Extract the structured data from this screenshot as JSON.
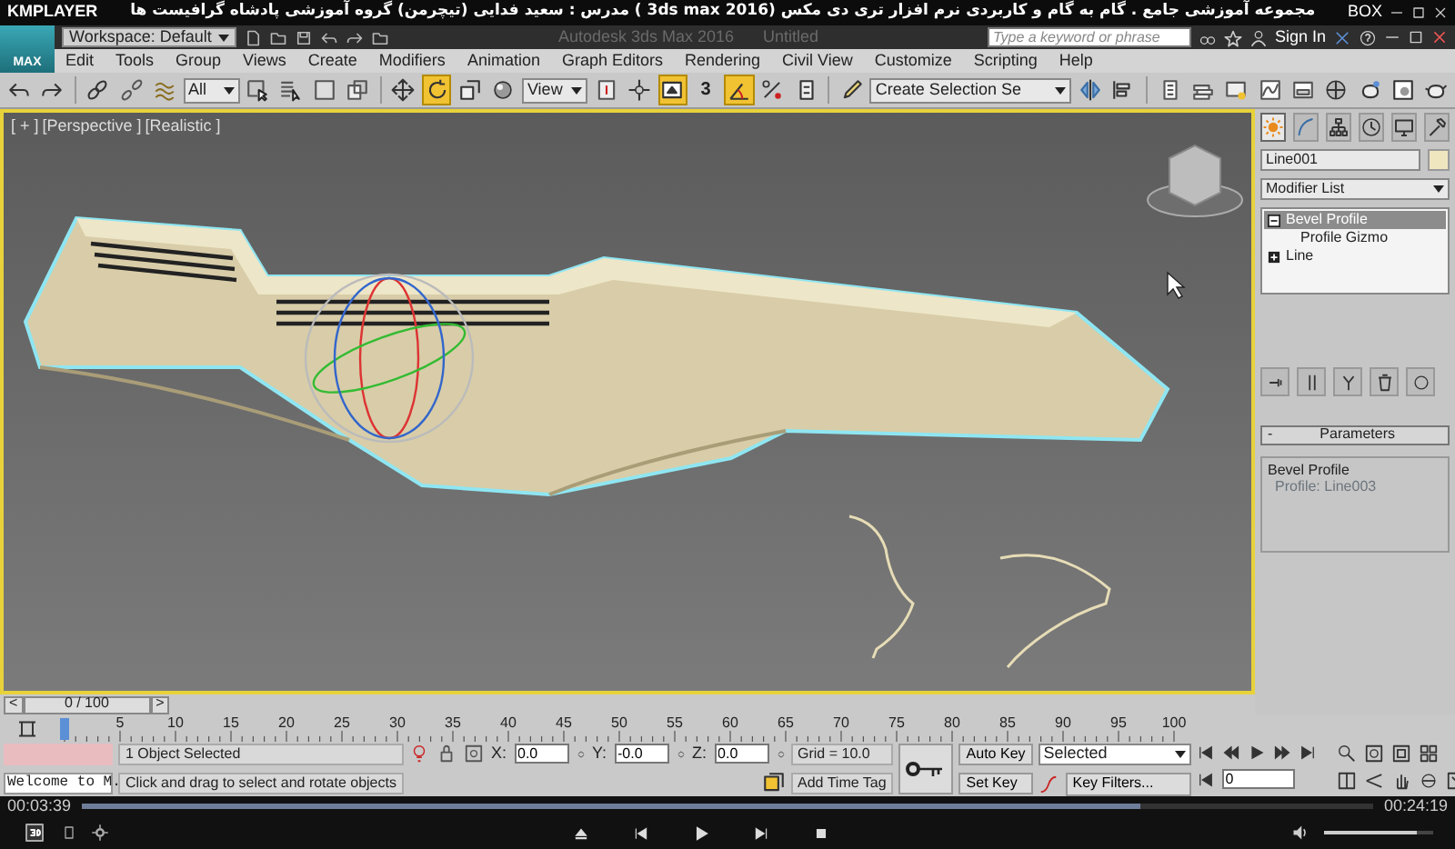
{
  "player": {
    "app_name": "KMPLAYER",
    "title": "مجموعه آموزشی جامع . گام به گام و کاربردی نرم افزار تری دی مکس (3ds max 2016 ) مدرس : سعید فدایی (تیچرمن) گروه آموزشی پادشاه گرافیست ها",
    "box_label": "BOX",
    "elapsed": "00:03:39",
    "duration": "00:24:19",
    "progress": {
      "level": 0.82
    },
    "volume": {
      "level": 0.85
    }
  },
  "app": {
    "logo_label": "MAX",
    "workspace": "Workspace: Default",
    "title": "Autodesk 3ds Max 2016",
    "document": "Untitled",
    "search": {
      "placeholder": "Type a keyword or phrase"
    },
    "sign_in": "Sign In"
  },
  "menu": [
    "Edit",
    "Tools",
    "Group",
    "Views",
    "Create",
    "Modifiers",
    "Animation",
    "Graph Editors",
    "Rendering",
    "Civil View",
    "Customize",
    "Scripting",
    "Help"
  ],
  "toolbar": [
    {
      "kind": "button",
      "active": false
    },
    {
      "kind": "button",
      "active": false
    },
    {
      "kind": "separator"
    },
    {
      "kind": "button",
      "active": false
    },
    {
      "kind": "button",
      "active": false
    },
    {
      "kind": "button",
      "active": false
    },
    {
      "kind": "dropdown",
      "value": "All"
    },
    {
      "kind": "button",
      "active": false
    },
    {
      "kind": "button",
      "active": false
    },
    {
      "kind": "button",
      "active": false
    },
    {
      "kind": "button",
      "active": false
    },
    {
      "kind": "separator"
    },
    {
      "kind": "button",
      "active": false
    },
    {
      "kind": "button",
      "active": true
    },
    {
      "kind": "button",
      "active": false
    },
    {
      "kind": "button",
      "active": false
    },
    {
      "kind": "dropdown",
      "value": "View"
    },
    {
      "kind": "button",
      "active": false
    },
    {
      "kind": "button",
      "active": false
    },
    {
      "kind": "button",
      "active": true
    },
    {
      "kind": "text_button",
      "text": "3",
      "active": false
    },
    {
      "kind": "button",
      "active": true
    },
    {
      "kind": "button",
      "active": false
    },
    {
      "kind": "button",
      "active": false
    },
    {
      "kind": "separator"
    },
    {
      "kind": "button",
      "active": false
    },
    {
      "kind": "dropdown",
      "value": "Create Selection Se"
    },
    {
      "kind": "button",
      "active": false
    },
    {
      "kind": "button",
      "active": false
    },
    {
      "kind": "separator"
    },
    {
      "kind": "button",
      "active": false
    },
    {
      "kind": "button",
      "active": false
    },
    {
      "kind": "button",
      "active": false
    },
    {
      "kind": "button",
      "active": false
    },
    {
      "kind": "button",
      "active": false
    },
    {
      "kind": "button",
      "active": false
    },
    {
      "kind": "button",
      "active": false
    },
    {
      "kind": "button",
      "active": false
    },
    {
      "kind": "button",
      "active": false
    }
  ],
  "viewport": {
    "active": true,
    "labels": [
      "[ + ]",
      "[Perspective ]",
      "[Realistic ]"
    ]
  },
  "time_slider": {
    "prev": "<",
    "position": "0 / 100",
    "next": ">"
  },
  "ruler": {
    "ticks": [
      "5",
      "10",
      "15",
      "20",
      "25",
      "30",
      "35",
      "40",
      "45",
      "50",
      "55",
      "60",
      "65",
      "70",
      "75",
      "80",
      "85",
      "90",
      "95",
      "100"
    ]
  },
  "command_panel": {
    "tabs": [
      {
        "selected": true
      },
      {
        "selected": false
      },
      {
        "selected": false
      },
      {
        "selected": false
      },
      {
        "selected": false
      },
      {
        "selected": false
      }
    ],
    "object_name": "Line001",
    "modifier_list": "Modifier List",
    "stack": [
      {
        "label": "Bevel Profile",
        "selected": true,
        "expanded": true,
        "children": [
          {
            "label": "Profile Gizmo",
            "selected": false
          }
        ]
      },
      {
        "label": "Line",
        "selected": false,
        "expanded": false
      }
    ],
    "rollout": {
      "toggle": "-",
      "title": "Parameters",
      "group": "Bevel Profile",
      "profile": "Profile: Line003"
    }
  },
  "status": {
    "listener": "Welcome to M.",
    "selection": "1 Object Selected",
    "prompt": "Click and drag to select and rotate objects",
    "coords": [
      {
        "axis": "X:",
        "value": "0.0"
      },
      {
        "axis": "Y:",
        "value": "-0.0"
      },
      {
        "axis": "Z:",
        "value": "0.0"
      }
    ],
    "grid": "Grid = 10.0",
    "time_tag": "Add Time Tag",
    "auto_key": {
      "label": "Auto Key",
      "on": false
    },
    "set_key": "Set Key",
    "key_mode": "Selected",
    "key_filters": "Key Filters...",
    "frame": "0"
  }
}
